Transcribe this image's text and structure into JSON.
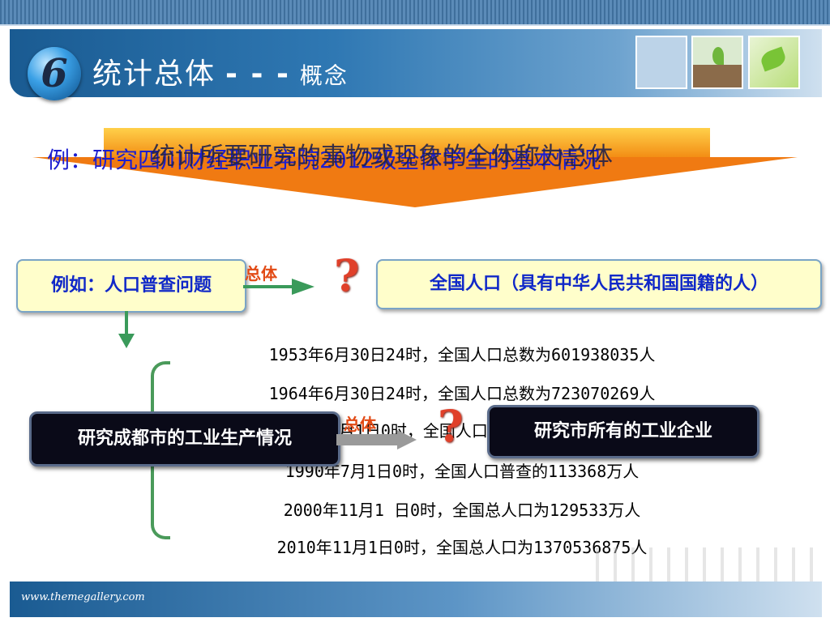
{
  "header": {
    "badge_number": "6",
    "title_main": "统计总体",
    "title_dashes": "- - -",
    "title_sub": "概念"
  },
  "banner_example": {
    "text": "例：研究四川财经职业学院2012级全体学生的基本情况",
    "overlay_text": "统计所要研究的事物或现象的全体称为总体"
  },
  "diagram": {
    "example1_label": "例如：人口普查问题",
    "total_label_1": "总体",
    "population_label": "全国人口（具有中华人民共和国国籍的人）",
    "example2_label": "研究成都市的工业生产情况",
    "total_label_2": "总体",
    "enterprise_label": "研究市所有的工业企业",
    "census_lines": [
      "1953年6月30日24时，全国人口总数为601938035人",
      "1964年6月30日24时，全国人口总数为723070269人",
      "1982年7月1日0时，全国人口总数为1008175288人",
      "1990年7月1日0时，全国人口普查的113368万人",
      "2000年11月1 日0时，全国总人口为129533万人",
      "2010年11月1日0时，全国总人口为1370536875人"
    ]
  },
  "footer": {
    "url": "www.themegallery.com"
  }
}
